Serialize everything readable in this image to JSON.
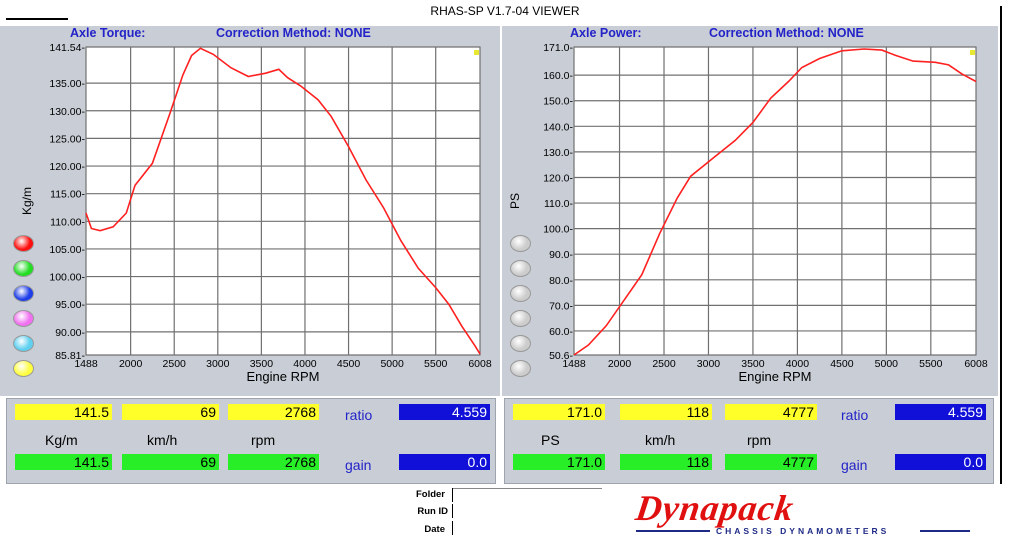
{
  "window": {
    "title": "RHAS-SP V1.7-04  VIEWER"
  },
  "chart_data": [
    {
      "type": "line",
      "title": "Axle Torque:",
      "correction": "Correction Method: NONE",
      "xlabel": "Engine RPM",
      "ylabel": "Kg/m",
      "xlim": [
        1488,
        6008
      ],
      "ylim": [
        85.81,
        141.54
      ],
      "x_ticks": [
        1488,
        2000,
        2500,
        3000,
        3500,
        4000,
        4500,
        5000,
        5500,
        6008
      ],
      "x_tick_labels": [
        "1488",
        "2000",
        "2500",
        "3000",
        "3500",
        "4000",
        "4500",
        "5000",
        "5500",
        "6008"
      ],
      "y_ticks": [
        141.54,
        135,
        130,
        125,
        120,
        115,
        110,
        105,
        100,
        95,
        90,
        85.81
      ],
      "y_tick_labels": [
        "141.54-",
        "135.00-",
        "130.00-",
        "125.00-",
        "120.00-",
        "115.00-",
        "110.00-",
        "105.00-",
        "100.00-",
        "95.00-",
        "90.00-",
        "85.81-"
      ],
      "series": [
        {
          "color": "#ff2020",
          "x": [
            1488,
            1550,
            1650,
            1800,
            1950,
            2050,
            2250,
            2450,
            2600,
            2700,
            2800,
            2950,
            3150,
            3350,
            3550,
            3700,
            3800,
            3950,
            4150,
            4300,
            4500,
            4700,
            4900,
            5100,
            5300,
            5500,
            5650,
            5800,
            5950,
            6008
          ],
          "y": [
            111.5,
            108.7,
            108.3,
            109.0,
            111.5,
            116.5,
            120.5,
            129.5,
            136.5,
            140.0,
            141.3,
            140.2,
            137.8,
            136.2,
            136.8,
            137.5,
            136.0,
            134.5,
            132.0,
            129.0,
            123.5,
            117.5,
            112.5,
            106.5,
            101.5,
            98.0,
            95.0,
            91.0,
            87.5,
            86.0
          ]
        }
      ],
      "legend_dots": [
        "#ff1010",
        "#22dd22",
        "#1e3ee8",
        "#f070f0",
        "#5fd0f0",
        "#ffff40"
      ],
      "readout": {
        "top": [
          "141.5",
          "69",
          "2768"
        ],
        "bottom": [
          "141.5",
          "69",
          "2768"
        ],
        "units": [
          "Kg/m",
          "km/h",
          "rpm"
        ],
        "ratio_label": "ratio",
        "ratio_value": "4.559",
        "gain_label": "gain",
        "gain_value": "0.0"
      }
    },
    {
      "type": "line",
      "title": "Axle Power:",
      "correction": "Correction Method: NONE",
      "xlabel": "Engine RPM",
      "ylabel": "PS",
      "xlim": [
        1488,
        6008
      ],
      "ylim": [
        50.6,
        171.0
      ],
      "x_ticks": [
        1488,
        2000,
        2500,
        3000,
        3500,
        4000,
        4500,
        5000,
        5500,
        6008
      ],
      "x_tick_labels": [
        "1488",
        "2000",
        "2500",
        "3000",
        "3500",
        "4000",
        "4500",
        "5000",
        "5500",
        "6008"
      ],
      "y_ticks": [
        171,
        160,
        150,
        140,
        130,
        120,
        110,
        100,
        90,
        80,
        70,
        60,
        50.6
      ],
      "y_tick_labels": [
        "171.0-",
        "160.0-",
        "150.0-",
        "140.0-",
        "130.0-",
        "120.0-",
        "110.0-",
        "100.0-",
        "90.0-",
        "80.0-",
        "70.0-",
        "60.0-",
        "50.6-"
      ],
      "series": [
        {
          "color": "#ff2020",
          "x": [
            1488,
            1650,
            1850,
            2050,
            2250,
            2450,
            2650,
            2800,
            3050,
            3300,
            3500,
            3700,
            3900,
            4050,
            4250,
            4500,
            4750,
            4950,
            5100,
            5300,
            5550,
            5700,
            5850,
            6008
          ],
          "y": [
            50.6,
            54.5,
            62.0,
            72.0,
            82.0,
            98.0,
            112.0,
            120.5,
            127.5,
            134.5,
            141.5,
            151.0,
            157.5,
            163.0,
            166.5,
            169.5,
            170.2,
            169.8,
            167.8,
            165.5,
            165.0,
            164.0,
            160.5,
            157.5
          ]
        }
      ],
      "legend_dots": [
        "#cccccc",
        "#cccccc",
        "#cccccc",
        "#cccccc",
        "#cccccc",
        "#cccccc"
      ],
      "readout": {
        "top": [
          "171.0",
          "118",
          "4777"
        ],
        "bottom": [
          "171.0",
          "118",
          "4777"
        ],
        "units": [
          "PS",
          "km/h",
          "rpm"
        ],
        "ratio_label": "ratio",
        "ratio_value": "4.559",
        "gain_label": "gain",
        "gain_value": "0.0"
      }
    }
  ],
  "meta": {
    "folder_label": "Folder",
    "runid_label": "Run ID",
    "date_label": "Date"
  },
  "logo": {
    "brand": "Dynapack",
    "tagline": "CHASSIS DYNAMOMETERS"
  }
}
